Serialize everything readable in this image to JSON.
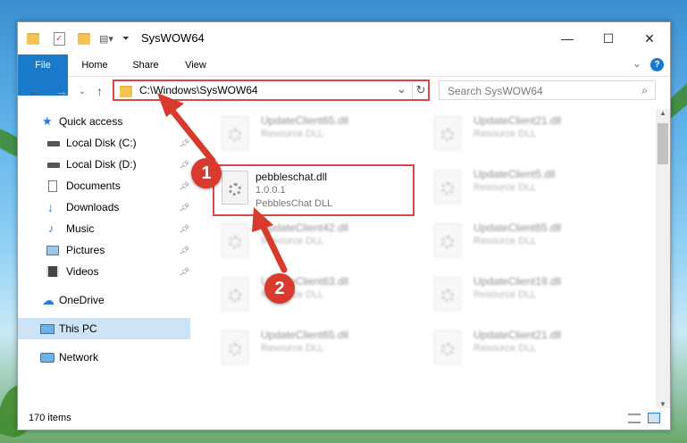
{
  "window": {
    "title": "SysWOW64",
    "controls": {
      "minimize": "—",
      "maximize": "☐",
      "close": "✕"
    }
  },
  "ribbon": {
    "tabs": [
      "File",
      "Home",
      "Share",
      "View"
    ],
    "collapse_glyph": "⌄",
    "help_glyph": "?"
  },
  "address_bar": {
    "path": "C:\\Windows\\SysWOW64",
    "dropdown_glyph": "⌄",
    "refresh_glyph": "↻"
  },
  "search": {
    "placeholder": "Search SysWOW64"
  },
  "sidebar": {
    "quick_access": "Quick access",
    "items": [
      {
        "label": "Local Disk (C:)",
        "icon": "drive-icon",
        "pinned": true
      },
      {
        "label": "Local Disk (D:)",
        "icon": "drive-icon",
        "pinned": true
      },
      {
        "label": "Documents",
        "icon": "documents-icon",
        "pinned": true
      },
      {
        "label": "Downloads",
        "icon": "downloads-icon",
        "pinned": true
      },
      {
        "label": "Music",
        "icon": "music-icon",
        "pinned": true
      },
      {
        "label": "Pictures",
        "icon": "pictures-icon",
        "pinned": true
      },
      {
        "label": "Videos",
        "icon": "videos-icon",
        "pinned": true
      }
    ],
    "onedrive": "OneDrive",
    "this_pc": "This PC",
    "network": "Network"
  },
  "files": {
    "selected": {
      "name": "pebbleschat.dll",
      "version": "1.0.0.1",
      "description": "PebblesChat DLL"
    },
    "left_column": [
      {
        "name": "UpdateClient65.dll",
        "type": "Resource DLL"
      },
      {
        "name": "UpdateClient42.dll",
        "type": "Resource DLL"
      },
      {
        "name": "UpdateClient63.dll",
        "type": "Resource DLL"
      },
      {
        "name": "UpdateClient65.dll",
        "type": "Resource DLL"
      }
    ],
    "right_column": [
      {
        "name": "UpdateClient21.dll",
        "type": "Resource DLL"
      },
      {
        "name": "UpdateClient5.dll",
        "type": "Resource DLL"
      },
      {
        "name": "UpdateClient65.dll",
        "type": "Resource DLL"
      },
      {
        "name": "UpdateClient19.dll",
        "type": "Resource DLL"
      },
      {
        "name": "UpdateClient21.dll",
        "type": "Resource DLL"
      }
    ]
  },
  "status": {
    "item_count": "170 items"
  },
  "annotations": {
    "step1": "1",
    "step2": "2",
    "color": "#d83b2d"
  }
}
